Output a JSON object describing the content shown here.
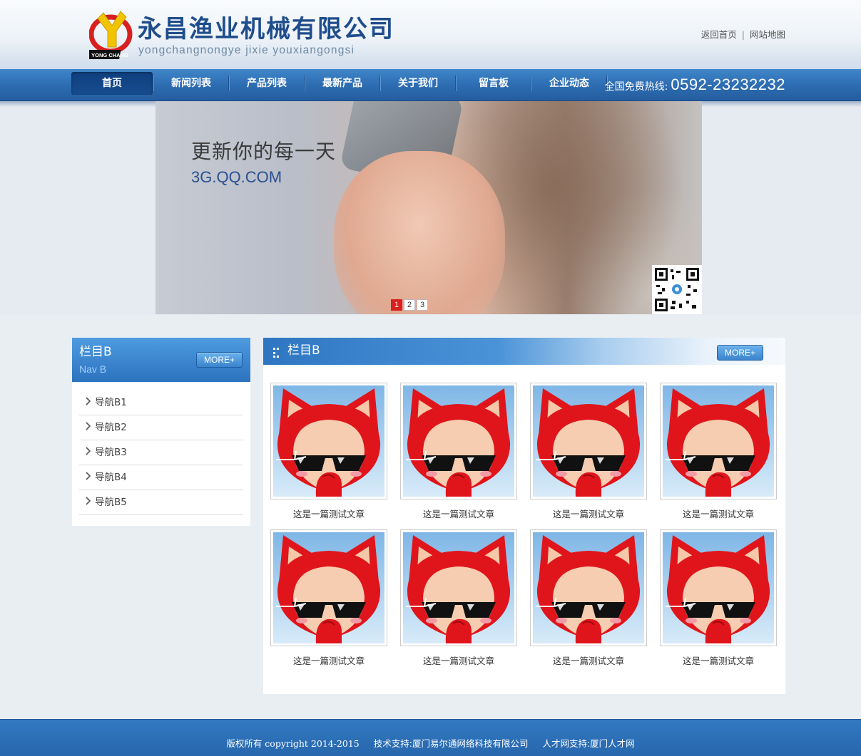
{
  "header": {
    "company_name": "永昌渔业机械有限公司",
    "company_pinyin": "yongchangnongye jixie youxiangongsi",
    "logo_text": "YONG CHANG",
    "top_links": {
      "home": "返回首页",
      "separator": "|",
      "sitemap": "网站地图"
    }
  },
  "nav": {
    "items": [
      {
        "label": "首页",
        "active": true
      },
      {
        "label": "新闻列表"
      },
      {
        "label": "产品列表"
      },
      {
        "label": "最新产品"
      },
      {
        "label": "关于我们"
      },
      {
        "label": "留言板"
      },
      {
        "label": "企业动态"
      }
    ],
    "hotline_label": "全国免费热线:",
    "hotline_number": "0592-23232232"
  },
  "banner": {
    "headline": "更新你的每一天",
    "subline": "3G.QQ.COM",
    "pages": [
      "1",
      "2",
      "3"
    ],
    "current_page": "1"
  },
  "sidebar": {
    "title": "栏目B",
    "subtitle": "Nav B",
    "more_label": "MORE+",
    "items": [
      "导航B1",
      "导航B2",
      "导航B3",
      "导航B4",
      "导航B5"
    ]
  },
  "main": {
    "title": "栏目B",
    "more_label": "MORE+",
    "cards": [
      {
        "caption": "这是一篇测试文章"
      },
      {
        "caption": "这是一篇测试文章"
      },
      {
        "caption": "这是一篇测试文章"
      },
      {
        "caption": "这是一篇测试文章"
      },
      {
        "caption": "这是一篇测试文章"
      },
      {
        "caption": "这是一篇测试文章"
      },
      {
        "caption": "这是一篇测试文章"
      },
      {
        "caption": "这是一篇测试文章"
      }
    ]
  },
  "footer": {
    "copyright": "版权所有 copyright 2014-2015",
    "tech_support": "技术支持:厦门易尔通网络科技有限公司",
    "talent_support": "人才网支持:厦门人才网"
  },
  "colors": {
    "brand_blue": "#2e6db2",
    "active_nav": "#0f3f7e",
    "page_dot_active": "#d7201f"
  },
  "icons": {
    "logo": "yongchang-logo-icon",
    "qr": "qr-code-icon",
    "chevron": "chevron-right-icon",
    "thumbnail": "red-fox-mascot-icon"
  }
}
